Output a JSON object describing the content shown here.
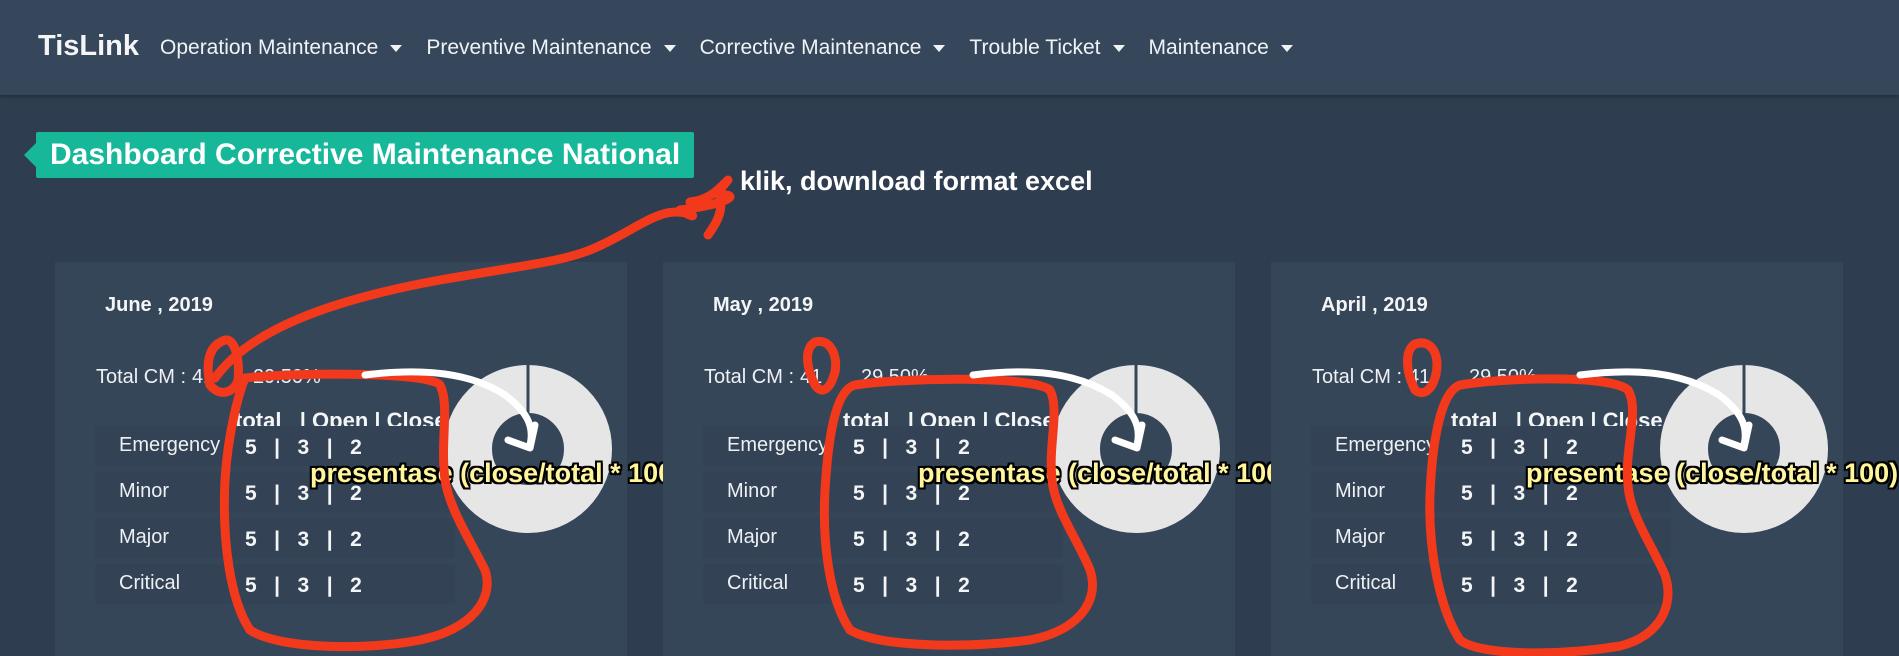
{
  "app": {
    "brand": "TisLink"
  },
  "nav": {
    "items": [
      {
        "label": "Operation Maintenance"
      },
      {
        "label": "Preventive Maintenance"
      },
      {
        "label": "Corrective Maintenance"
      },
      {
        "label": "Trouble Ticket"
      },
      {
        "label": "Maintenance"
      }
    ]
  },
  "page": {
    "title": "Dashboard Corrective Maintenance National",
    "annotation_note": "klik, download format excel"
  },
  "table_header": "total   | Open | Close",
  "annotation_label": "presentase (close/total * 100)",
  "cards": [
    {
      "period": "June , 2019",
      "total_cm_label": "Total CM :",
      "total_cm_value": "41",
      "percent": "29.50%",
      "rows": [
        {
          "label": "Emergency",
          "nums": "5   |   3   |   2"
        },
        {
          "label": "Minor",
          "nums": "5   |   3   |   2"
        },
        {
          "label": "Major",
          "nums": "5   |   3   |   2"
        },
        {
          "label": "Critical",
          "nums": "5   |   3   |   2"
        }
      ]
    },
    {
      "period": "May , 2019",
      "total_cm_label": "Total CM :",
      "total_cm_value": "41",
      "percent": "29.50%",
      "rows": [
        {
          "label": "Emergency",
          "nums": "5   |   3   |   2"
        },
        {
          "label": "Minor",
          "nums": "5   |   3   |   2"
        },
        {
          "label": "Major",
          "nums": "5   |   3   |   2"
        },
        {
          "label": "Critical",
          "nums": "5   |   3   |   2"
        }
      ]
    },
    {
      "period": "April , 2019",
      "total_cm_label": "Total CM :",
      "total_cm_value": "41",
      "percent": "29.50%",
      "rows": [
        {
          "label": "Emergency",
          "nums": "5   |   3   |   2"
        },
        {
          "label": "Minor",
          "nums": "5   |   3   |   2"
        },
        {
          "label": "Major",
          "nums": "5   |   3   |   2"
        },
        {
          "label": "Critical",
          "nums": "5   |   3   |   2"
        }
      ]
    }
  ],
  "colors": {
    "navbar": "#37475b",
    "background": "#2e3d4f",
    "card": "#364659",
    "accent": "#17b89a",
    "annotation_stroke": "#f2391b",
    "annotation_text": "#fff59a",
    "donut": "#e6e6e6"
  }
}
